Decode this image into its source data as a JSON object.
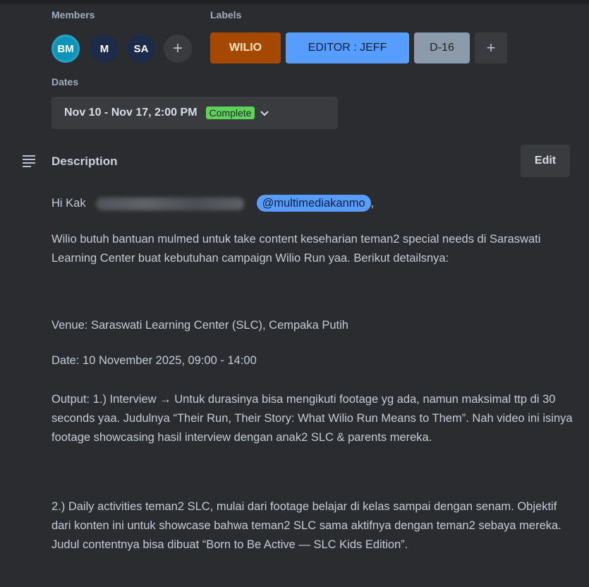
{
  "members": {
    "label": "Members",
    "avatars": [
      "BM",
      "M",
      "SA"
    ],
    "add": "+"
  },
  "labels": {
    "label": "Labels",
    "items": [
      "WILIO",
      "EDITOR : JEFF",
      "D-16"
    ],
    "add": "+"
  },
  "dates": {
    "label": "Dates",
    "value": "Nov 10 - Nov 17, 2:00 PM",
    "status": "Complete",
    "chevron": "⌄"
  },
  "description": {
    "title": "Description",
    "edit_label": "Edit",
    "greeting": "Hi Kak",
    "mention": "@multimediakanmo",
    "mention_after": ",",
    "intro": "Wilio butuh bantuan mulmed untuk take content keseharian teman2 special needs di Saraswati Learning Center buat kebutuhan campaign Wilio Run yaa. Berikut detailsnya:",
    "venue": "Venue: Saraswati Learning Center (SLC), Cempaka Putih",
    "date": "Date: 10 November 2025, 09:00 - 14:00",
    "output1": "Output: 1.) Interview → Untuk durasinya bisa mengikuti footage yg ada, namun maksimal ttp di 30 seconds yaa. Judulnya “Their Run, Their Story: What Wilio Run Means to Them”. Nah video ini isinya footage showcasing hasil interview dengan anak2 SLC & parents mereka.",
    "output2": "2.) Daily activities teman2 SLC, mulai dari footage belajar di kelas sampai dengan senam. Objektif dari konten ini untuk showcase bahwa teman2 SLC sama aktifnya dengan teman2 sebaya mereka. Judul contentnya bisa dibuat “Born to Be Active — SLC Kids Edition”."
  }
}
